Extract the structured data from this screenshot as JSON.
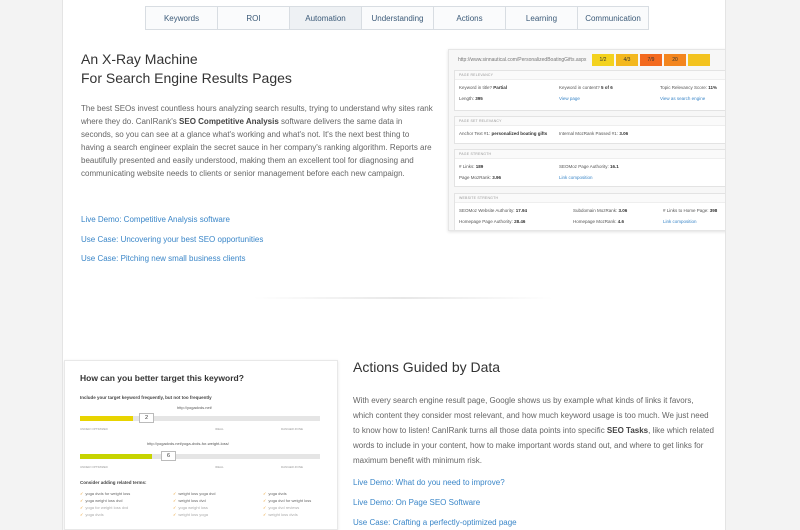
{
  "tabs": [
    {
      "label": "Keywords"
    },
    {
      "label": "ROI"
    },
    {
      "label": "Automation",
      "active": true
    },
    {
      "label": "Understanding"
    },
    {
      "label": "Actions"
    },
    {
      "label": "Learning"
    },
    {
      "label": "Communication"
    }
  ],
  "section1": {
    "title_line1": "An X-Ray Machine",
    "title_line2": "For Search Engine Results Pages",
    "body_pre": "The best SEOs invest countless hours analyzing search results, trying to understand why sites rank where they do. CanIRank's ",
    "body_bold": "SEO Competitive Analysis",
    "body_post": " software delivers the same data in seconds, so you can see at a glance what's working and what's not. It's the next best thing to having a search engineer explain the secret sauce in her company's ranking algorithm. Reports are beautifully presented and easily understood, making them an excellent tool for diagnosing and communicating website needs to clients or senior management before each new campaign.",
    "links": [
      "Live Demo: Competitive Analysis software",
      "Use Case: Uncovering your best SEO opportunities",
      "Use Case: Pitching new small business clients"
    ]
  },
  "screenshot1": {
    "url": "http://www.sinnautical.com/PersonalizedBoatingGifts.aspx",
    "scores": [
      {
        "value": "1/2",
        "color": "#f3d21f"
      },
      {
        "value": "4/3",
        "color": "#f3b81f"
      },
      {
        "value": "7/9",
        "color": "#f36a1f"
      },
      {
        "value": "20",
        "color": "#f3861f"
      },
      {
        "value": "",
        "color": "#f3c31f"
      }
    ],
    "page_relevancy": {
      "header": "PAGE RELEVANCY",
      "keyword_in_title_label": "Keyword in title?",
      "keyword_in_title_value": "Partial",
      "length_label": "Length:",
      "length_value": "395",
      "keyword_in_content_label": "Keyword in content?",
      "keyword_in_content_value": "5 of 6",
      "view_page": "View page",
      "topic_score_label": "Topic Relevancy Score:",
      "topic_score_value": "11%",
      "view_as_search_engine": "View as search engine"
    },
    "page_set_relevancy": {
      "header": "PAGE SET RELEVANCY",
      "anchor_label": "Anchor Text #1:",
      "anchor_value": "personalized boating gifts",
      "internal_label": "Internal MozRank Passed #1:",
      "internal_value": "3.06"
    },
    "page_strength": {
      "header": "PAGE STRENGTH",
      "links_label": "# Links:",
      "links_value": "189",
      "pagemozrank_label": "Page MozRank:",
      "pagemozrank_value": "3.96",
      "authority_label": "SEOMoz Page Authority:",
      "authority_value": "16.1",
      "link_composition": "Link composition"
    },
    "website_strength": {
      "header": "WEBSITE STRENGTH",
      "site_authority_label": "SEOMoz Website Authority:",
      "site_authority_value": "17.94",
      "home_authority_label": "Homepage Page Authority:",
      "home_authority_value": "28.46",
      "subdomain_label": "Subdomain MozRank:",
      "subdomain_value": "3.06",
      "home_mozrank_label": "Homepage MozRank:",
      "home_mozrank_value": "4.6",
      "links_home_label": "# Links to Home Page:",
      "links_home_value": "398",
      "link_composition": "Link composition"
    }
  },
  "section2": {
    "title": "Actions Guided by Data",
    "body_pre": "With every search engine result page, Google shows us by example what kinds of links it favors, which content they consider most relevant, and how much keyword usage is too much. We just need to know how to listen! CanIRank turns all those data points into specific ",
    "body_bold": "SEO Tasks",
    "body_post": ", like which related words to include in your content, how to make important words stand out, and where to get links for maximum benefit with minimum risk.",
    "links": [
      "Live Demo: What do you need to improve?",
      "Live Demo: On Page SEO Software",
      "Use Case: Crafting a perfectly-optimized page"
    ]
  },
  "screenshot2": {
    "title": "How can you better target this keyword?",
    "subtitle": "Include your target keyword frequently, but not too frequently",
    "url1": "http://yogadvds.net/",
    "count1": "2",
    "fill1": 0.22,
    "url2": "http://yogadvds.net/yoga-dvds-for-weight-loss/",
    "count2": "6",
    "fill2": 0.3,
    "zone_under": "UNDER OPTIMIZED",
    "zone_ideal": "IDEAL",
    "zone_danger": "DANGER ZONE",
    "consider_label": "Consider adding related terms:",
    "terms_col1": [
      "yoga dvds for weight loss",
      "yoga weight loss dvd",
      "yoga for weight loss dvd",
      "yoga dvds"
    ],
    "terms_col2": [
      "weight loss yoga dvd",
      "weight loss dvd",
      "yoga weight loss",
      "weight loss yoga"
    ],
    "terms_col3": [
      "yoga dvds",
      "yoga dvd for weight loss",
      "yoga dvd reviews",
      "weight loss dvds"
    ]
  }
}
